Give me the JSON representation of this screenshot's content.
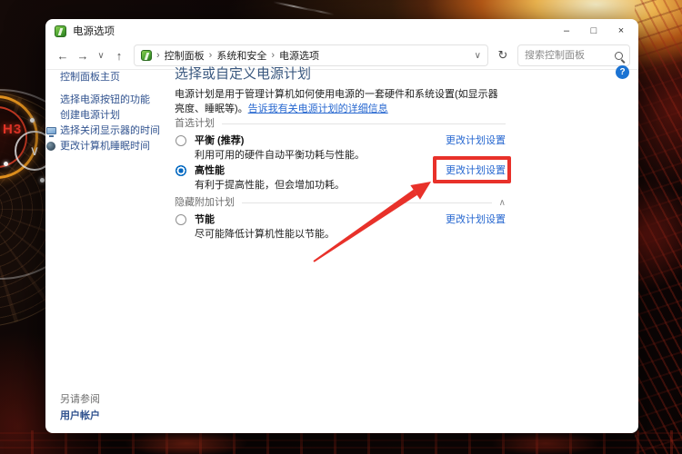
{
  "desktop": {
    "gauge_label": "H3",
    "gauge_check_glyph": "∨"
  },
  "window": {
    "title": "电源选项",
    "controls": {
      "minimize": "–",
      "maximize": "□",
      "close": "×"
    }
  },
  "navbar": {
    "back": "←",
    "forward": "→",
    "recent_dropdown": "∨",
    "up": "↑",
    "refresh": "↻",
    "breadcrumb": {
      "separator": "›",
      "items": [
        "控制面板",
        "系统和安全",
        "电源选项"
      ]
    },
    "address_dropdown": "∨",
    "search_placeholder": "搜索控制面板",
    "help_glyph": "?"
  },
  "sidebar": {
    "home": "控制面板主页",
    "items": [
      {
        "label": "选择电源按钮的功能"
      },
      {
        "label": "创建电源计划"
      },
      {
        "label": "选择关闭显示器的时间"
      },
      {
        "label": "更改计算机睡眠时间"
      }
    ],
    "see_also": "另请参阅",
    "see_also_link": "用户帐户"
  },
  "main": {
    "heading": "选择或自定义电源计划",
    "intro": "电源计划是用于管理计算机如何使用电源的一套硬件和系统设置(如显示器亮度、睡眠等)。",
    "intro_link": "告诉我有关电源计划的详细信息",
    "section_preferred": {
      "title": "首选计划"
    },
    "section_hidden": {
      "title": "隐藏附加计划",
      "collapse_glyph": "∧"
    },
    "plans": [
      {
        "name": "平衡 (推荐)",
        "desc": "利用可用的硬件自动平衡功耗与性能。",
        "link": "更改计划设置",
        "selected": false
      },
      {
        "name": "高性能",
        "desc": "有利于提高性能，但会增加功耗。",
        "link": "更改计划设置",
        "selected": true
      },
      {
        "name": "节能",
        "desc": "尽可能降低计算机性能以节能。",
        "link": "更改计划设置",
        "selected": false
      }
    ]
  },
  "colors": {
    "accent_blue": "#0067c0",
    "link_blue": "#2667d0",
    "annotation_red": "#e8312a"
  }
}
